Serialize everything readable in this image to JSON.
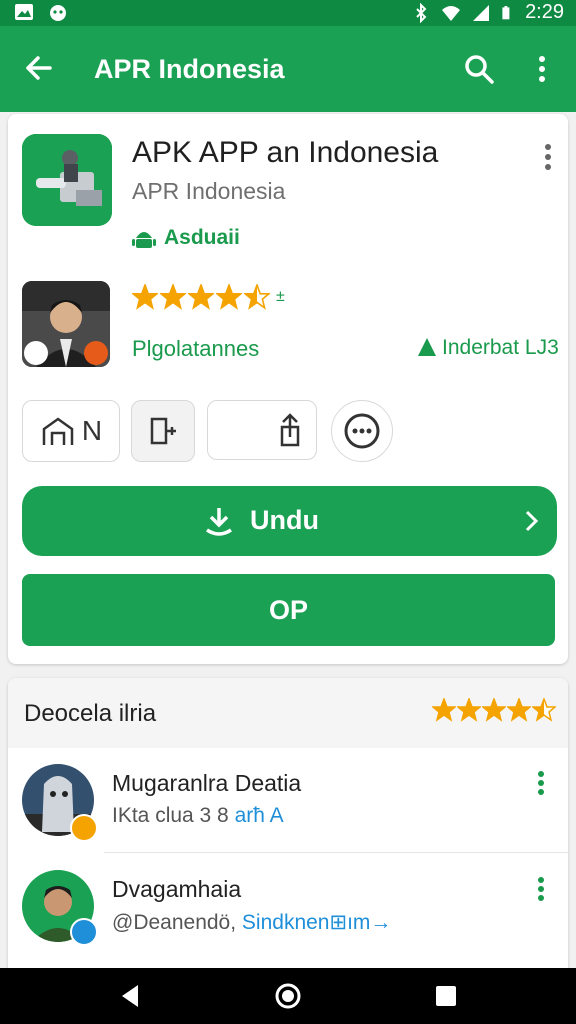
{
  "status_bar": {
    "time": "2:29",
    "icons": [
      "image-icon",
      "cat-icon",
      "bluetooth-icon",
      "wifi-icon",
      "signal-icon",
      "battery-icon"
    ]
  },
  "app_bar": {
    "title": "APR Indonesia",
    "icons": [
      "back-arrow-icon",
      "search-icon",
      "overflow-menu-icon"
    ]
  },
  "app_card": {
    "name": "APK APP an Indonesia",
    "developer": "APR Indonesia",
    "badge": "Asduaii",
    "rating_value": 4.5,
    "rating_suffix": "±",
    "rating_label": "Plgolatannes",
    "right_label": "Inderbat LJ3",
    "action_chips": [
      {
        "label": "N",
        "icon": "house-icon"
      },
      {
        "label": "",
        "icon": "speaker-icon"
      },
      {
        "label": "",
        "icon": "share-icon"
      },
      {
        "label": "",
        "icon": "more-circle-icon"
      }
    ],
    "primary_button": "Undu",
    "secondary_button": "OP"
  },
  "reviews": {
    "section_title": "Deocela ilria",
    "section_rating": 4.5,
    "items": [
      {
        "name": "Mugaranlra Deatia",
        "meta_prefix": "IKta clua 3 8 ",
        "meta_link": "arħ A",
        "badge_color": "#f4a300"
      },
      {
        "name": "Dvagamhaia",
        "meta_prefix": "@Deanendö, ",
        "meta_link": "Sindknen⊞ım→",
        "badge_color": "#1f8fd9"
      }
    ]
  },
  "nav_bar": {
    "icons": [
      "back-triangle-icon",
      "home-circle-icon",
      "recents-square-icon"
    ]
  },
  "colors": {
    "primary": "#1aa153",
    "status_bar": "#0e8a42",
    "star": "#f4a300",
    "link": "#1f8fd9"
  }
}
